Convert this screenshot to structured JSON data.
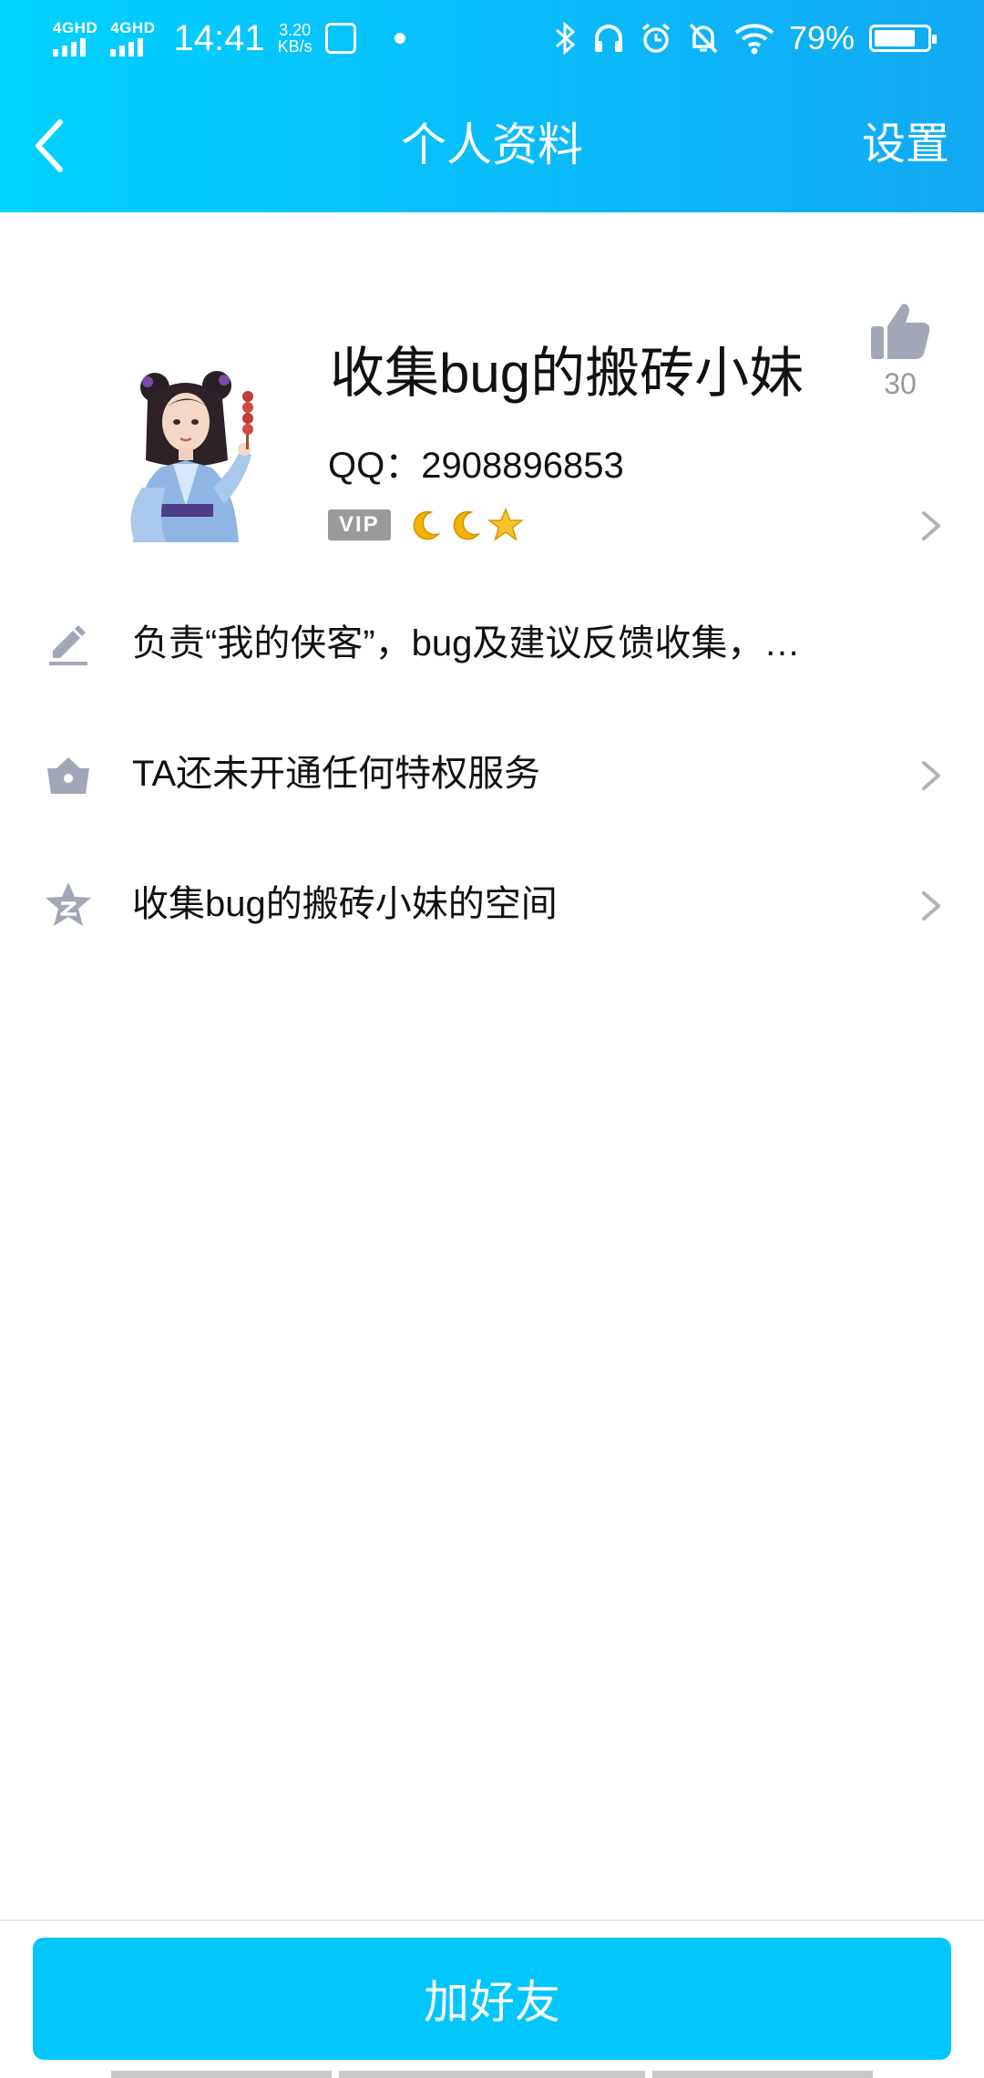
{
  "status_bar": {
    "sim1": "4GHD",
    "sim2": "4GHD",
    "time": "14:41",
    "speed_value": "3.20",
    "speed_unit": "KB/s",
    "battery": "79%"
  },
  "nav": {
    "title": "个人资料",
    "settings": "设置"
  },
  "profile": {
    "name": "收集bug的搬砖小妹",
    "qq": "QQ：2908896853",
    "vip_badge": "VIP",
    "likes": "30"
  },
  "rows": [
    {
      "text": "负责“我的侠客”，bug及建议反馈收集，…",
      "icon": "edit-icon"
    },
    {
      "text": "TA还未开通任何特权服务",
      "icon": "crown-bag-icon"
    },
    {
      "text": "收集bug的搬砖小妹的空间",
      "icon": "qzone-star-icon"
    }
  ],
  "add_friend_button": "加好友",
  "colors": {
    "header_start": "#00d2ff",
    "header_end": "#12a9f2",
    "button": "#00c6fb",
    "icon_gray": "#a2a7b8"
  }
}
